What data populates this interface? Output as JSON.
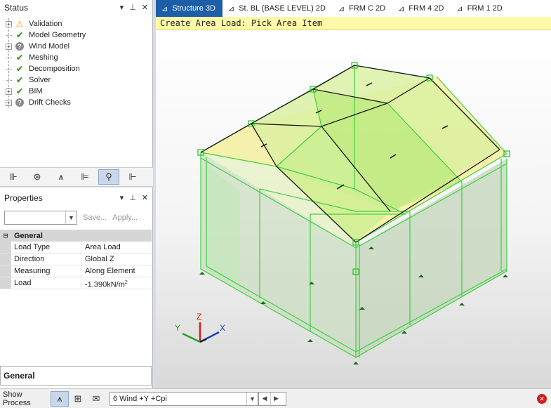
{
  "status_panel": {
    "title": "Status",
    "items": [
      {
        "label": "Validation",
        "state": "warning",
        "expandable": true
      },
      {
        "label": "Model Geometry",
        "state": "ok",
        "expandable": false
      },
      {
        "label": "Wind Model",
        "state": "unknown",
        "expandable": true
      },
      {
        "label": "Meshing",
        "state": "ok",
        "expandable": false
      },
      {
        "label": "Decomposition",
        "state": "ok",
        "expandable": false
      },
      {
        "label": "Solver",
        "state": "ok",
        "expandable": false
      },
      {
        "label": "BIM",
        "state": "ok",
        "expandable": true
      },
      {
        "label": "Drift Checks",
        "state": "unknown",
        "expandable": true
      }
    ]
  },
  "properties_panel": {
    "title": "Properties",
    "combo_value": "",
    "save_label": "Save...",
    "apply_label": "Apply...",
    "group_label": "General",
    "rows": [
      {
        "key": "Load Type",
        "value": "Area Load"
      },
      {
        "key": "Direction",
        "value": "Global Z"
      },
      {
        "key": "Measuring",
        "value": "Along Element"
      },
      {
        "key": "Load",
        "value": "-1.390kN/m",
        "unit_sup": "2"
      }
    ],
    "description_title": "General"
  },
  "tabs": [
    {
      "label": "Structure 3D",
      "active": true
    },
    {
      "label": "St. BL (BASE LEVEL) 2D",
      "active": false
    },
    {
      "label": "FRM C 2D",
      "active": false
    },
    {
      "label": "FRM 4 2D",
      "active": false
    },
    {
      "label": "FRM 1 2D",
      "active": false
    }
  ],
  "hint": "Create Area Load: Pick Area Item",
  "axes": {
    "x": "X",
    "y": "Y",
    "z": "Z"
  },
  "statusbar": {
    "label": "Show Process",
    "loadcase": "6 Wind +Y +Cpi"
  },
  "colors": {
    "tab_active": "#1c5fa8",
    "hint_bg": "#fffaa8",
    "selection_green": "#3cd23c",
    "roof_yellow": "#f5f0a0",
    "error_red": "#d0201c"
  }
}
